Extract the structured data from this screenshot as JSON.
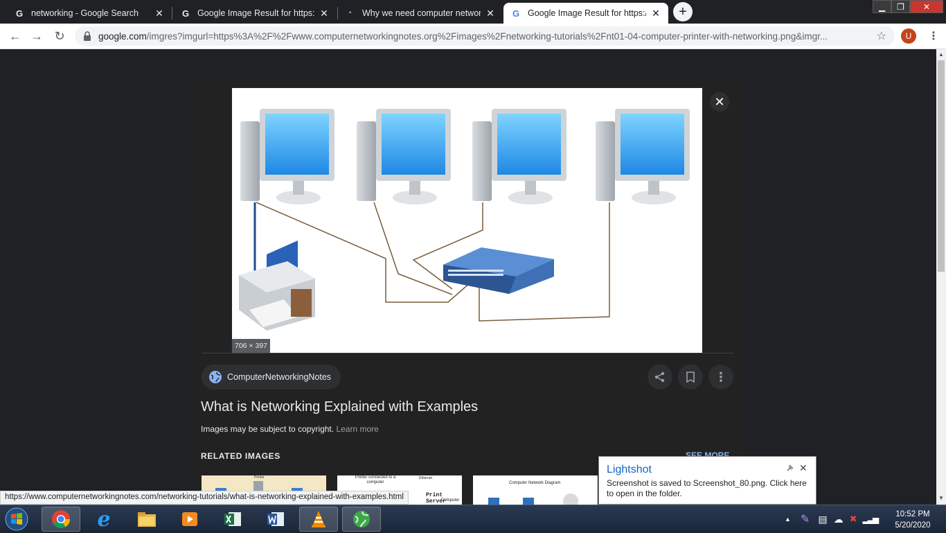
{
  "browser": {
    "tabs": [
      {
        "title": "networking - Google Search",
        "favicon": "google-g-icon",
        "active": false
      },
      {
        "title": "Google Image Result for https://w",
        "favicon": "google-g-icon",
        "active": false
      },
      {
        "title": "Why we need computer network",
        "favicon": "loading-spinner-icon",
        "active": false
      },
      {
        "title": "Google Image Result for https://w",
        "favicon": "google-g-icon",
        "active": true
      }
    ],
    "new_tab_label": "+",
    "url_host": "google.com",
    "url_rest": "/imgres?imgurl=https%3A%2F%2Fwww.computernetworkingnotes.org%2Fimages%2Fnetworking-tutorials%2Fnt01-04-computer-printer-with-networking.png&imgr...",
    "profile_initial": "U"
  },
  "viewer": {
    "image_dimensions": "706 × 397",
    "close_label": "✕",
    "source_name": "ComputerNetworkingNotes",
    "title": "What is Networking Explained with Examples",
    "copyright_text": "Images may be subject to copyright.",
    "learn_more": "Learn more",
    "related_heading": "RELATED IMAGES",
    "see_more": "SEE MORE",
    "related_thumbs": [
      {
        "caption": "Printer"
      },
      {
        "caption": "Printer connected to a computer"
      },
      {
        "caption": "Computer Network Diagram"
      }
    ],
    "thumb_extra_text": {
      "server_label": "Print Server",
      "computer_label": "Computer",
      "ethernet_label": "Ethernet"
    }
  },
  "status_url": "https://www.computernetworkingnotes.com/networking-tutorials/what-is-networking-explained-with-examples.html",
  "lightshot": {
    "title": "Lightshot",
    "body": "Screenshot is saved to Screenshot_80.png. Click here to open in the folder.",
    "close_label": "✕"
  },
  "taskbar": {
    "apps": [
      "chrome-icon",
      "internet-explorer-icon",
      "file-explorer-icon",
      "media-player-icon",
      "excel-icon",
      "word-icon",
      "vlc-icon",
      "browser-globe-icon"
    ],
    "time": "10:52 PM",
    "date": "5/20/2020"
  },
  "colors": {
    "accent": "#8ab4f8",
    "panel": "#222222",
    "page_bg": "#202124",
    "lightshot_title": "#1565c0"
  }
}
